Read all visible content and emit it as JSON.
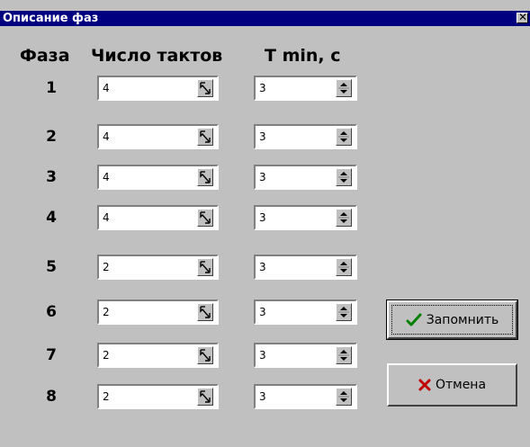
{
  "window": {
    "title": "Описание фаз",
    "close_glyph": "✕"
  },
  "headers": {
    "phase": "Фаза",
    "cycles": "Число тактов",
    "tmin": "T min, с"
  },
  "rows": [
    {
      "phase": "1",
      "cycles": "4",
      "tmin": "3"
    },
    {
      "phase": "2",
      "cycles": "4",
      "tmin": "3"
    },
    {
      "phase": "3",
      "cycles": "4",
      "tmin": "3"
    },
    {
      "phase": "4",
      "cycles": "4",
      "tmin": "3"
    },
    {
      "phase": "5",
      "cycles": "2",
      "tmin": "3"
    },
    {
      "phase": "6",
      "cycles": "2",
      "tmin": "3"
    },
    {
      "phase": "7",
      "cycles": "2",
      "tmin": "3"
    },
    {
      "phase": "8",
      "cycles": "2",
      "tmin": "3"
    }
  ],
  "buttons": {
    "save": {
      "label": "Запомнить",
      "icon": "checkmark-icon",
      "icon_color": "#008000"
    },
    "cancel": {
      "label": "Отмена",
      "icon": "cross-icon",
      "icon_color": "#c00000"
    }
  },
  "colors": {
    "titlebar": "#000080",
    "face": "#c0c0c0"
  }
}
